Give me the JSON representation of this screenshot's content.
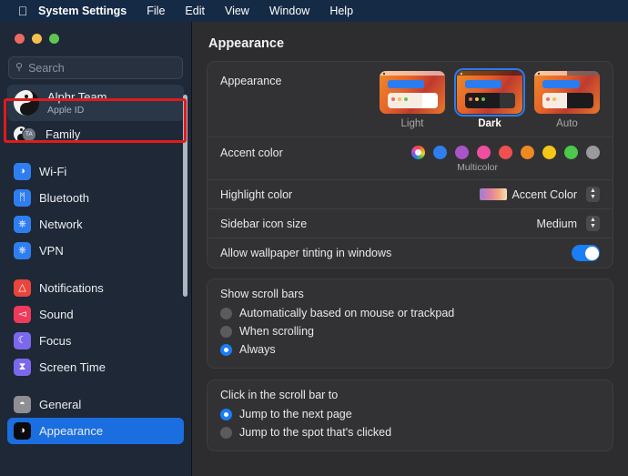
{
  "menubar": {
    "apple_icon": "apple-logo",
    "items": [
      {
        "label": "System Settings",
        "bold": true
      },
      {
        "label": "File",
        "bold": false
      },
      {
        "label": "Edit",
        "bold": false
      },
      {
        "label": "View",
        "bold": false
      },
      {
        "label": "Window",
        "bold": false
      },
      {
        "label": "Help",
        "bold": false
      }
    ]
  },
  "sidebar": {
    "search": {
      "placeholder": "Search",
      "icon": "search-icon"
    },
    "account": {
      "name": "Alphr Team",
      "subtitle": "Apple ID",
      "avatar": "yin-yang-avatar"
    },
    "family": {
      "label": "Family",
      "badge": "TA",
      "avatar": "yin-yang-avatar"
    },
    "groups": [
      {
        "items": [
          {
            "label": "Wi-Fi",
            "icon": "wifi-icon",
            "color": "#2f7ef0",
            "glyph": "◞"
          },
          {
            "label": "Bluetooth",
            "icon": "bluetooth-icon",
            "color": "#2f7ef0",
            "glyph": "ᛗ"
          },
          {
            "label": "Network",
            "icon": "globe-icon",
            "color": "#2f7ef0",
            "glyph": "⊕"
          },
          {
            "label": "VPN",
            "icon": "vpn-icon",
            "color": "#2f7ef0",
            "glyph": "⌾"
          }
        ]
      },
      {
        "items": [
          {
            "label": "Notifications",
            "icon": "bell-icon",
            "color": "#e8453c",
            "glyph": "▲"
          },
          {
            "label": "Sound",
            "icon": "speaker-icon",
            "color": "#ee3b5b",
            "glyph": "◀"
          },
          {
            "label": "Focus",
            "icon": "moon-icon",
            "color": "#7b68ee",
            "glyph": "☾"
          },
          {
            "label": "Screen Time",
            "icon": "hourglass-icon",
            "color": "#7b68ee",
            "glyph": "⧗"
          }
        ]
      },
      {
        "items": [
          {
            "label": "General",
            "icon": "gear-icon",
            "color": "#8e8e93",
            "glyph": "◔"
          },
          {
            "label": "Appearance",
            "icon": "appearance-icon",
            "color": "#0b0b0d",
            "glyph": "◑",
            "selected": true
          }
        ]
      }
    ]
  },
  "content": {
    "title": "Appearance",
    "appearance": {
      "label": "Appearance",
      "options": [
        {
          "label": "Light",
          "selected": false
        },
        {
          "label": "Dark",
          "selected": true
        },
        {
          "label": "Auto",
          "selected": false
        }
      ]
    },
    "accent": {
      "label": "Accent color",
      "caption": "Multicolor",
      "colors": [
        {
          "name": "multicolor",
          "hex": "multicolor"
        },
        {
          "name": "blue",
          "hex": "#2f7ef0"
        },
        {
          "name": "purple",
          "hex": "#a855c8"
        },
        {
          "name": "pink",
          "hex": "#ef4f9f"
        },
        {
          "name": "red",
          "hex": "#f05050"
        },
        {
          "name": "orange",
          "hex": "#f08a20"
        },
        {
          "name": "yellow",
          "hex": "#f5c518"
        },
        {
          "name": "green",
          "hex": "#4cc84c"
        },
        {
          "name": "graphite",
          "hex": "#9a9a9a"
        }
      ]
    },
    "highlight": {
      "label": "Highlight color",
      "value": "Accent Color"
    },
    "sidebar_icon_size": {
      "label": "Sidebar icon size",
      "value": "Medium"
    },
    "wallpaper_tinting": {
      "label": "Allow wallpaper tinting in windows",
      "enabled": true
    },
    "scroll_bars": {
      "title": "Show scroll bars",
      "options": [
        {
          "label": "Automatically based on mouse or trackpad",
          "selected": false
        },
        {
          "label": "When scrolling",
          "selected": false
        },
        {
          "label": "Always",
          "selected": true
        }
      ]
    },
    "scroll_click": {
      "title": "Click in the scroll bar to",
      "options": [
        {
          "label": "Jump to the next page",
          "selected": true
        },
        {
          "label": "Jump to the spot that's clicked",
          "selected": false
        }
      ]
    }
  },
  "annotation": {
    "color": "#e11b1b",
    "target": "account-row"
  }
}
